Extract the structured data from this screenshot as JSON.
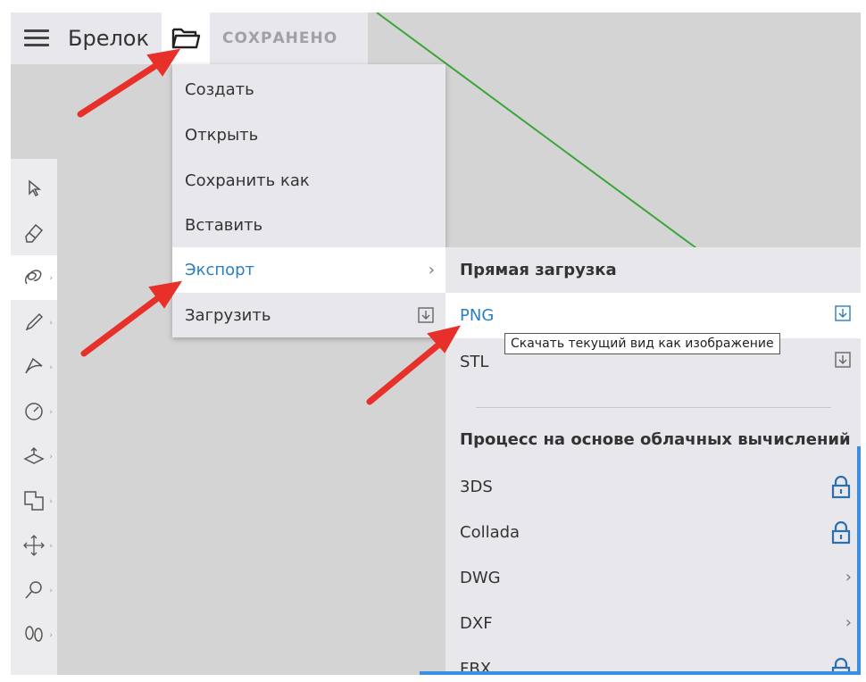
{
  "topbar": {
    "doc_title": "Брелок",
    "saved_status": "СОХРАНЕНО",
    "icons": {
      "menu": "hamburger-icon",
      "file": "folder-open-icon"
    }
  },
  "file_menu": {
    "items": [
      {
        "label": "Создать"
      },
      {
        "label": "Открыть"
      },
      {
        "label": "Сохранить как"
      },
      {
        "label": "Вставить"
      },
      {
        "label": "Экспорт",
        "has_submenu": true,
        "highlighted": true
      },
      {
        "label": "Загрузить",
        "icon": "download-icon"
      }
    ]
  },
  "export_submenu": {
    "direct_header": "Прямая загрузка",
    "direct_items": [
      {
        "label": "PNG",
        "icon": "download-icon",
        "highlighted": true
      },
      {
        "label": "STL",
        "icon": "download-icon"
      }
    ],
    "cloud_header": "Процесс на основе облачных вычислений",
    "cloud_items": [
      {
        "label": "3DS",
        "icon": "lock-icon"
      },
      {
        "label": "Collada",
        "icon": "lock-icon"
      },
      {
        "label": "DWG",
        "icon": "chevron-right-icon"
      },
      {
        "label": "DXF",
        "icon": "chevron-right-icon"
      },
      {
        "label": "FBX",
        "icon": "lock-icon"
      }
    ]
  },
  "tooltip": {
    "text": "Скачать текущий вид как изображение"
  },
  "toolbar": {
    "tools": [
      "select-arrow-icon",
      "eraser-icon",
      "freehand-icon",
      "pencil-icon",
      "arc-icon",
      "circle-icon",
      "push-pull-icon",
      "offset-icon",
      "move-icon",
      "paint-icon",
      "footprints-icon"
    ]
  },
  "colors": {
    "accent": "#2a7fbf",
    "annotation_arrow": "#e8302a",
    "green_axis": "#3aa63a",
    "frame_blue": "#3a8fe0"
  }
}
